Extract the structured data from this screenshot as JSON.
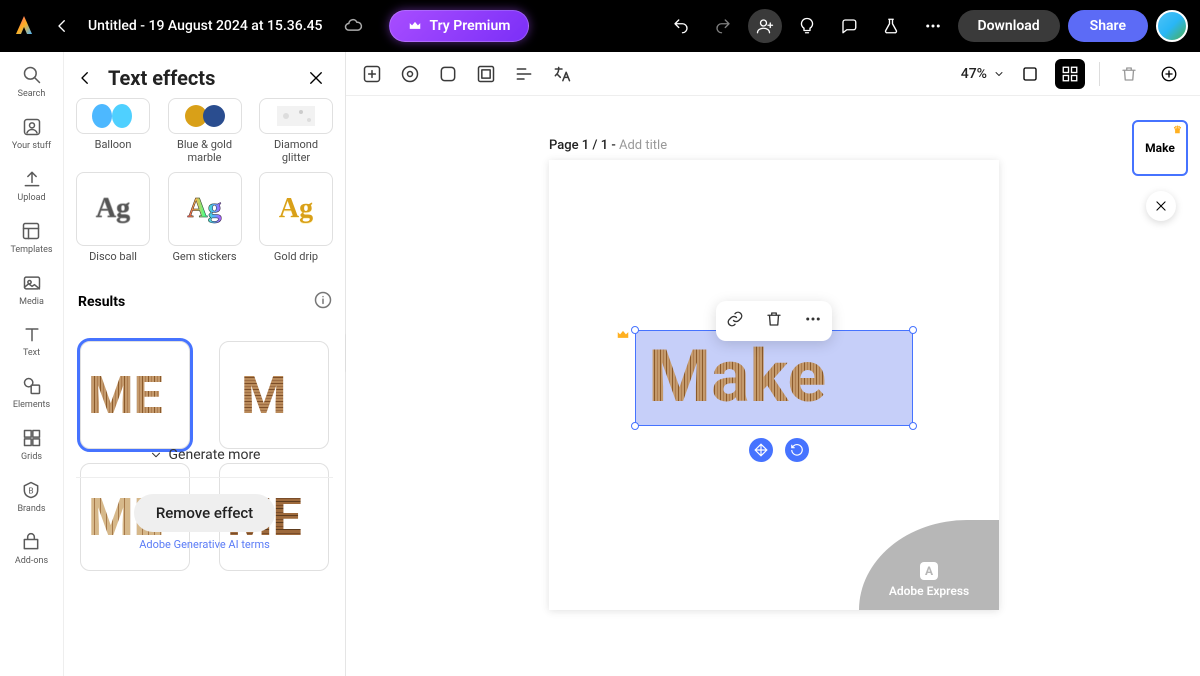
{
  "header": {
    "doc_title": "Untitled - 19 August 2024 at 15.36.45",
    "try_premium": "Try Premium",
    "download": "Download",
    "share": "Share"
  },
  "left_rail": [
    {
      "id": "search",
      "label": "Search",
      "icon": "search-icon"
    },
    {
      "id": "your-stuff",
      "label": "Your stuff",
      "icon": "user-box-icon"
    },
    {
      "id": "upload",
      "label": "Upload",
      "icon": "upload-icon"
    },
    {
      "id": "templates",
      "label": "Templates",
      "icon": "templates-icon"
    },
    {
      "id": "media",
      "label": "Media",
      "icon": "media-icon"
    },
    {
      "id": "text",
      "label": "Text",
      "icon": "text-icon"
    },
    {
      "id": "elements",
      "label": "Elements",
      "icon": "shapes-icon"
    },
    {
      "id": "grids",
      "label": "Grids",
      "icon": "grids-icon"
    },
    {
      "id": "brands",
      "label": "Brands",
      "icon": "brands-icon"
    },
    {
      "id": "addons",
      "label": "Add-ons",
      "icon": "addons-icon"
    }
  ],
  "panel": {
    "title": "Text effects",
    "effects_row1": [
      {
        "id": "balloon",
        "label": "Balloon"
      },
      {
        "id": "blue-gold-marble",
        "label": "Blue & gold marble"
      },
      {
        "id": "diamond-glitter",
        "label": "Diamond glitter"
      }
    ],
    "effects_row2": [
      {
        "id": "disco-ball",
        "label": "Disco ball"
      },
      {
        "id": "gem-stickers",
        "label": "Gem stickers"
      },
      {
        "id": "gold-drip",
        "label": "Gold drip"
      }
    ],
    "results_title": "Results",
    "results": [
      {
        "id": "result-1",
        "selected": true
      },
      {
        "id": "result-2",
        "selected": false
      },
      {
        "id": "result-3",
        "selected": false
      },
      {
        "id": "result-4",
        "selected": false
      }
    ],
    "generate_more": "Generate more",
    "remove_effect": "Remove effect",
    "terms": "Adobe Generative AI terms"
  },
  "toolbar": {
    "zoom": "47%"
  },
  "stage": {
    "page_prefix": "Page 1 / 1 - ",
    "add_title_placeholder": "Add title",
    "canvas_text": "Make",
    "branding": "Adobe Express",
    "page_thumb_text": "Make"
  },
  "colors": {
    "accent": "#4673ff",
    "premium": "#a84dff",
    "wood_light": "#c49a6c",
    "wood_dark": "#8b5a2b"
  }
}
